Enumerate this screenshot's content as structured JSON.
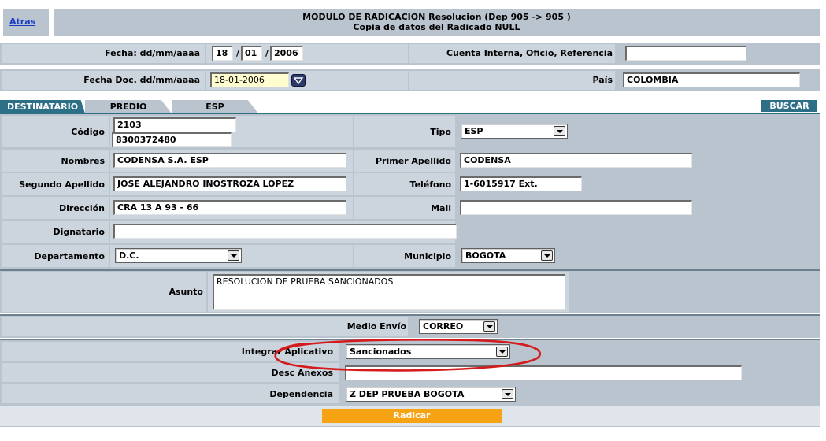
{
  "header": {
    "back_link": "Atras",
    "title_line1": "MODULO DE RADICACION Resolucion (Dep 905 -> 905 )",
    "title_line2": "Copia de datos del Radicado NULL"
  },
  "dates": {
    "fecha_label": "Fecha: dd/mm/aaaa",
    "day": "18",
    "month": "01",
    "year": "2006",
    "sep": "/",
    "cuenta_label": "Cuenta Interna, Oficio, Referencia",
    "cuenta_value": "",
    "fecha_doc_label": "Fecha Doc. dd/mm/aaaa",
    "fecha_doc_value": "18-01-2006",
    "pais_label": "País",
    "pais_value": "COLOMBIA"
  },
  "tabs": [
    {
      "label": "DESTINATARIO",
      "active": true
    },
    {
      "label": "PREDIO",
      "active": false
    },
    {
      "label": "ESP",
      "active": false
    }
  ],
  "buscar_label": "BUSCAR",
  "destinatario": {
    "codigo_label": "Código",
    "codigo_value1": "2103",
    "codigo_value2": "8300372480",
    "tipo_label": "Tipo",
    "tipo_value": "ESP",
    "nombres_label": "Nombres",
    "nombres_value": "CODENSA S.A. ESP",
    "primer_apellido_label": "Primer Apellido",
    "primer_apellido_value": "CODENSA",
    "segundo_apellido_label": "Segundo Apellido",
    "segundo_apellido_value": "JOSE ALEJANDRO INOSTROZA LOPEZ",
    "telefono_label": "Teléfono",
    "telefono_value": "1-6015917 Ext.",
    "direccion_label": "Dirección",
    "direccion_value": "CRA 13 A 93 - 66",
    "mail_label": "Mail",
    "mail_value": "",
    "dignatario_label": "Dignatario",
    "dignatario_value": "",
    "departamento_label": "Departamento",
    "departamento_value": "D.C.",
    "municipio_label": "Municipio",
    "municipio_value": "BOGOTA"
  },
  "asunto": {
    "label": "Asunto",
    "value": "RESOLUCION DE PRUEBA SANCIONADOS"
  },
  "envio": {
    "label": "Medio Envío",
    "value": "CORREO"
  },
  "aplicativo": {
    "label": "Integrar Aplicativo",
    "value": "Sancionados",
    "desc_anexos_label": "Desc Anexos",
    "desc_anexos_value": "",
    "dependencia_label": "Dependencia",
    "dependencia_value": "Z DEP PRUEBA BOGOTA"
  },
  "submit_label": "Radicar",
  "colors": {
    "panel": "#b9c4cf",
    "cell": "#ccd5de",
    "tab_active": "#2d6f87",
    "annotation_red": "#d41a1a",
    "submit": "#f5a313"
  }
}
